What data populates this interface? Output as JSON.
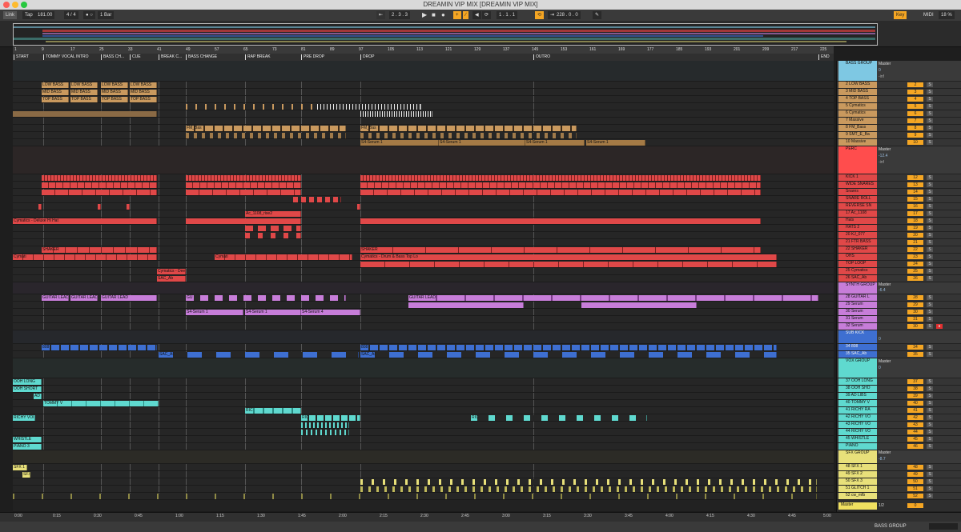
{
  "window": {
    "title": "DREAMIN VIP MIX  [DREAMIN VIP MIX]"
  },
  "control_bar": {
    "link": "Link",
    "tap": "Tap",
    "tempo": "181.00",
    "signature": "4 / 4",
    "metronome": "● ○",
    "quantize": "1 Bar",
    "arrangement_position": "2 .  3 .  3",
    "loop_start": "1 .  1 .  1",
    "loop_length": "228 .  0 .  0",
    "key": "Key",
    "midi": "MIDI",
    "cpu": "18 %"
  },
  "ruler": {
    "bars": [
      "1",
      "9",
      "17",
      "25",
      "33",
      "41",
      "49",
      "57",
      "65",
      "73",
      "81",
      "89",
      "97",
      "105",
      "113",
      "121",
      "129",
      "137",
      "145",
      "153",
      "161",
      "169",
      "177",
      "185",
      "193",
      "201",
      "209",
      "217",
      "225"
    ]
  },
  "locators": [
    {
      "label": "START"
    },
    {
      "label": "TOMMY VOCAL INTRO"
    },
    {
      "label": "BASS CH..."
    },
    {
      "label": "CUE"
    },
    {
      "label": "BREAK C..."
    },
    {
      "label": "BASS CHANGE"
    },
    {
      "label": "RAP BREAK"
    },
    {
      "label": "PRE DROP"
    },
    {
      "label": "DROP"
    },
    {
      "label": "OUTRO"
    },
    {
      "label": "END"
    }
  ],
  "clips": {
    "low_bass": "LOW BASS",
    "mid_bass": "MID BASS",
    "top_bass": "TOP BASS",
    "fm_bass": "FM_Bas",
    "serum_bass": "S4-Serum 1",
    "cymatics_hh": "Cymatics - Deluxe Hi Hat",
    "cymatics_dr": "Cymatics - Dr",
    "ac": "Ac_1108_rise2",
    "shaker": "SHAKER",
    "cymat": "Cymati",
    "drum_top": "Cymatics - Drum & Bass Top Lo",
    "cym_deep": "Cymatics - Dee",
    "sac": "SAC_Ab",
    "guitar_lead": "GUITAR LEAD",
    "gu": "GU",
    "serum_synth": "S4-Serum 1",
    "serum4": "S4-Serum 4",
    "bob": "808",
    "boi": "BOI",
    "sac_ai": "SAC_AI",
    "ooh_long": "OOH LONG",
    "ooh_short": "OOH SHORT",
    "ad": "AD",
    "tommy": "TOMMY V",
    "tom": "TOM",
    "richy": "RICHY VOI",
    "ric": "RIC",
    "whistle": "WHISTLE",
    "piano": "PIANO 3",
    "sfx1": "SFX 1",
    "sfx": "SFX"
  },
  "mixer": {
    "send_master": "Master",
    "zero": "0",
    "c": "C",
    "inf": "-inf",
    "groups": [
      {
        "name": "BASS GROUP",
        "vol": "0",
        "color": "#7ec8e3"
      },
      {
        "name": "PERC",
        "vol": "-12.4",
        "color": "#ff4d4d"
      },
      {
        "name": "SYNTH GROUP",
        "vol": "-6.4",
        "color": "#c77dd9"
      },
      {
        "name": "SUB KICK",
        "vol": "0",
        "color": "#3e6fd1"
      },
      {
        "name": "VOX GROUP",
        "vol": "0",
        "color": "#5fd9cf"
      },
      {
        "name": "SFX GROUP",
        "vol": "-8.7",
        "color": "#e8e07a"
      }
    ],
    "tracks": [
      {
        "name": "2 LOW BASS",
        "num": "2"
      },
      {
        "name": "3 MID BASS",
        "num": "3"
      },
      {
        "name": "4 TOP BASS",
        "num": "4"
      },
      {
        "name": "5 Cymatics",
        "num": "5"
      },
      {
        "name": "6 Cymatics",
        "num": "6"
      },
      {
        "name": "7 Massive",
        "num": "7"
      },
      {
        "name": "8 FM_Bass",
        "num": "8"
      },
      {
        "name": "9 SMT_E_Ba",
        "num": "9"
      },
      {
        "name": "10 Massive",
        "num": "10"
      },
      {
        "name": "KICK 1",
        "num": "12"
      },
      {
        "name": "WIDE SNARES",
        "num": "13"
      },
      {
        "name": "Snares",
        "num": "14"
      },
      {
        "name": "SNARE ROLL",
        "num": "15"
      },
      {
        "name": "REVERSE SN",
        "num": "16"
      },
      {
        "name": "17 Ac_1108",
        "num": "17"
      },
      {
        "name": "Hats",
        "num": "18"
      },
      {
        "name": "HATS 2",
        "num": "19"
      },
      {
        "name": "20 KJ_077",
        "num": "20"
      },
      {
        "name": "21 FTR BASS",
        "num": "21"
      },
      {
        "name": "22 SHAKER",
        "num": "22"
      },
      {
        "name": "OHS",
        "num": "23"
      },
      {
        "name": "TOP LOOP",
        "num": "24"
      },
      {
        "name": "25 Cymatics",
        "num": "25"
      },
      {
        "name": "26 SAC_Ab",
        "num": "26"
      },
      {
        "name": "28 GUITAR L",
        "num": "28"
      },
      {
        "name": "29 Serum",
        "num": "29"
      },
      {
        "name": "30 Serum",
        "num": "30"
      },
      {
        "name": "31 Serum",
        "num": "31"
      },
      {
        "name": "32 Serum",
        "num": "30"
      },
      {
        "name": "34 808",
        "num": "34"
      },
      {
        "name": "35 SAC_Ab",
        "num": "35"
      },
      {
        "name": "37 OOH LONG",
        "num": "37"
      },
      {
        "name": "38 OOH SHO",
        "num": "38"
      },
      {
        "name": "39 AD LIBS",
        "num": "39"
      },
      {
        "name": "40 TOMMY V",
        "num": "40"
      },
      {
        "name": "41 RICHY RA",
        "num": "41"
      },
      {
        "name": "42 RICHY VO",
        "num": "42"
      },
      {
        "name": "43 RICHY VO",
        "num": "43"
      },
      {
        "name": "44 RICHY VO",
        "num": "44"
      },
      {
        "name": "45 WHISTLE",
        "num": "45"
      },
      {
        "name": "PIANO",
        "num": "46"
      },
      {
        "name": "48 SFX 1",
        "num": "48"
      },
      {
        "name": "49 SFX 2",
        "num": "49"
      },
      {
        "name": "50 SFX 3",
        "num": "50"
      },
      {
        "name": "51 GLITCH 1",
        "num": "51"
      },
      {
        "name": "52 cw_mfb",
        "num": "52"
      }
    ],
    "master": {
      "name": "Master",
      "ratio": "1/2",
      "vol": "0"
    }
  },
  "timeline": {
    "ticks": [
      "0:00",
      "0:15",
      "0:30",
      "0:45",
      "1:00",
      "1:15",
      "1:30",
      "1:45",
      "2:00",
      "2:15",
      "2:30",
      "2:45",
      "3:00",
      "3:15",
      "3:30",
      "3:45",
      "4:00",
      "4:15",
      "4:30",
      "4:45",
      "5:00"
    ]
  },
  "status": {
    "selected_track": "BASS GROUP"
  }
}
